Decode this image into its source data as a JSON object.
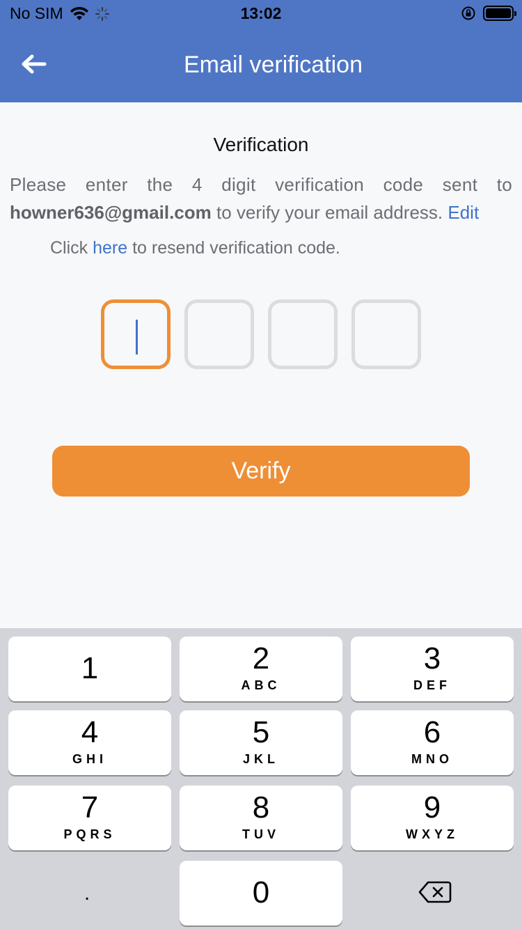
{
  "status_bar": {
    "carrier": "No SIM",
    "time": "13:02",
    "icons": [
      "wifi-icon",
      "activity-spinner-icon",
      "rotation-lock-icon",
      "battery-icon"
    ]
  },
  "app_bar": {
    "title": "Email verification",
    "back_icon": "arrow-left-icon",
    "background": "#4f76c5"
  },
  "content": {
    "heading": "Verification",
    "desc_line1": "Please enter the 4 digit verification code sent to",
    "email": "howner636@gmail.com",
    "desc_line2_rest": " to verify your email address. ",
    "edit_link": "Edit",
    "resend_prefix": "Click ",
    "resend_link": "here",
    "resend_suffix": " to resend verification code.",
    "code_boxes": [
      "",
      "",
      "",
      ""
    ],
    "active_box": 0,
    "verify_label": "Verify",
    "accent_color": "#ee8f36"
  },
  "keyboard": {
    "keys": [
      {
        "num": "1",
        "letters": ""
      },
      {
        "num": "2",
        "letters": "ABC"
      },
      {
        "num": "3",
        "letters": "DEF"
      },
      {
        "num": "4",
        "letters": "GHI"
      },
      {
        "num": "5",
        "letters": "JKL"
      },
      {
        "num": "6",
        "letters": "MNO"
      },
      {
        "num": "7",
        "letters": "PQRS"
      },
      {
        "num": "8",
        "letters": "TUV"
      },
      {
        "num": "9",
        "letters": "WXYZ"
      },
      {
        "num": "0",
        "letters": ""
      }
    ],
    "dot": ".",
    "backspace_icon": "backspace-icon"
  }
}
